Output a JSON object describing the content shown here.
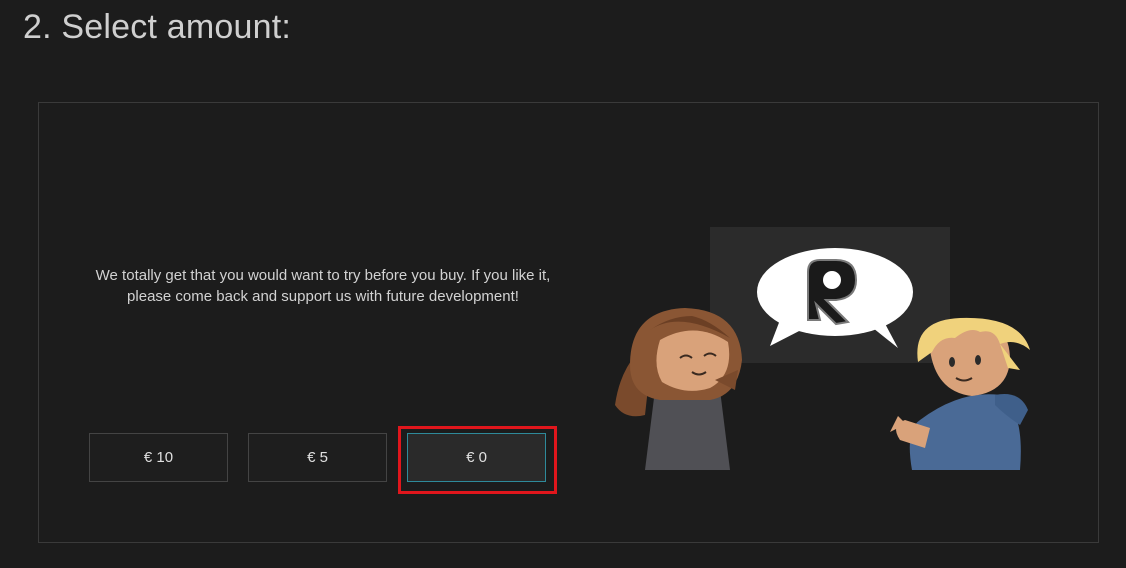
{
  "heading": "2. Select amount:",
  "message": "We totally get that you would want to try before you buy. If you like it, please come back and support us with future development!",
  "amounts": [
    {
      "label": "€ 10",
      "selected": false
    },
    {
      "label": "€ 5",
      "selected": false
    },
    {
      "label": "€ 0",
      "selected": true
    }
  ],
  "colors": {
    "background": "#1c1c1c",
    "selected_border": "#2e8a9a",
    "highlight": "#e0161c"
  }
}
